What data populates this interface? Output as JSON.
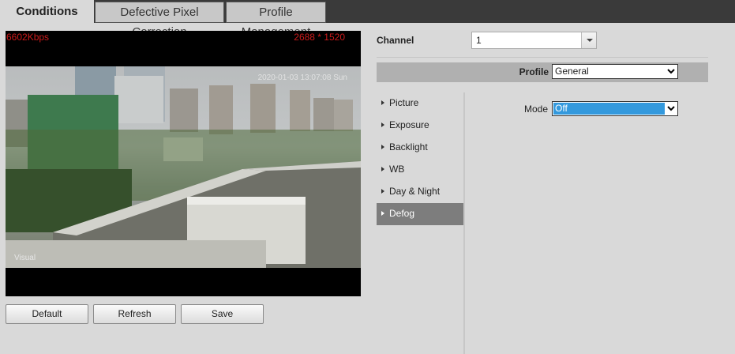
{
  "tabs": [
    {
      "label": "Conditions"
    },
    {
      "label": "Defective Pixel Correction"
    },
    {
      "label": "Profile Management"
    }
  ],
  "video": {
    "bitrate": "6602Kbps",
    "resolution": "2688 * 1520",
    "timestamp": "2020-01-03 13:07:08 Sun",
    "channel_name": "Visual"
  },
  "buttons": {
    "default": "Default",
    "refresh": "Refresh",
    "save": "Save"
  },
  "channel": {
    "label": "Channel",
    "value": "1"
  },
  "profile": {
    "label": "Profile",
    "value": "General"
  },
  "menu": [
    {
      "label": "Picture"
    },
    {
      "label": "Exposure"
    },
    {
      "label": "Backlight"
    },
    {
      "label": "WB"
    },
    {
      "label": "Day & Night"
    },
    {
      "label": "Defog"
    }
  ],
  "active_menu": "Defog",
  "defog": {
    "mode_label": "Mode",
    "mode_value": "Off"
  },
  "colors": {
    "accent_blue": "#3399dd",
    "osd_red": "#cc1a1a",
    "active_menu_bg": "#7d7d7d"
  }
}
